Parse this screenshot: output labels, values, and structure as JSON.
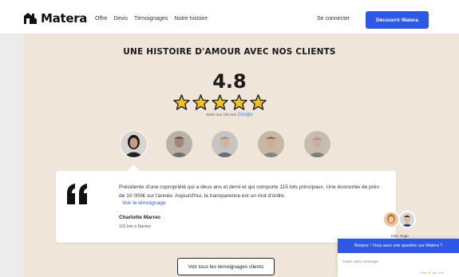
{
  "nav": {
    "brand": "Matera",
    "links": [
      "Offre",
      "Devis",
      "Témoignages",
      "Notre histoire"
    ],
    "login": "Se connecter",
    "cta": "Découvrir Matera"
  },
  "section": {
    "title": "UNE HISTOIRE D'AMOUR AVEC NOS CLIENTS",
    "rating": "4.8",
    "stars": 5,
    "reviews_prefix": "Selon nos 102 avis",
    "reviews_source": "Google",
    "star_color": "#f2c31f"
  },
  "testimonial": {
    "text": "Présidente d'une copropriété qui a deux ans et demi et qui comporte 115 lots principaux. Une économie de près de 10 000€ sur l'année. Aujourd'hui, la transparence est un mot d'ordre.",
    "link": "Voir le témoignage",
    "author": "Charlotte Marrec",
    "author_detail": "115 lots à Nantes"
  },
  "all_testimonials_button": "Voir tous les témoignages clients",
  "chat": {
    "agents": "Inès, Hugo",
    "greeting": "Bonjour ! Vous avez une question sur Matera ?",
    "placeholder": "Saisir votre message",
    "credit": "Chat ⚡ par Drift"
  },
  "colors": {
    "accent": "#2f57e6",
    "background": "#efe5d8"
  }
}
